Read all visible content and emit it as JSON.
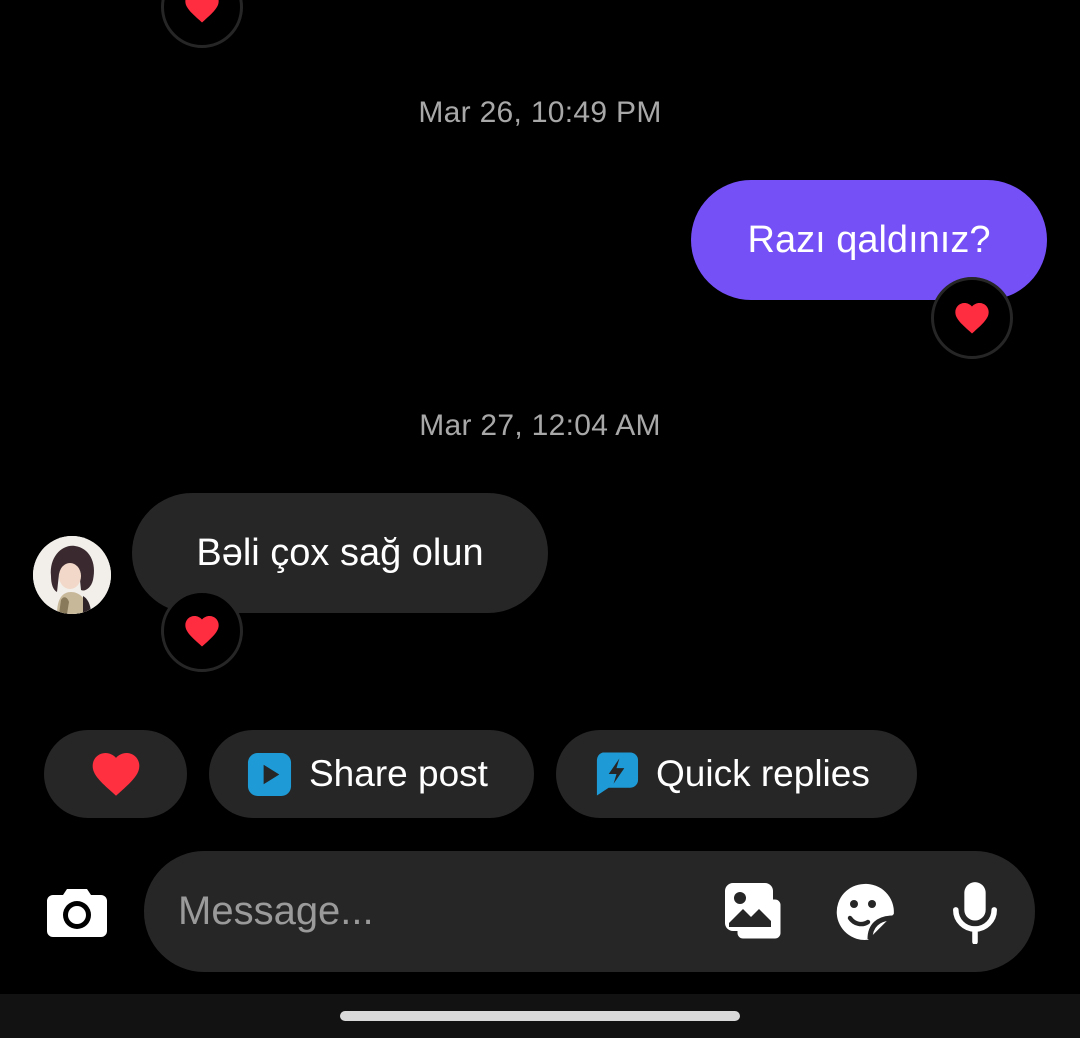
{
  "conversation": {
    "messages": [
      {
        "kind": "timestamp",
        "text": "Mar 26, 10:49 PM"
      },
      {
        "kind": "outgoing",
        "text": "Razı qaldınız?",
        "reaction": "red-heart"
      },
      {
        "kind": "timestamp",
        "text": "Mar 27, 12:04 AM"
      },
      {
        "kind": "incoming",
        "text": "Bəli çox sağ olun",
        "reaction": "red-heart"
      }
    ]
  },
  "quick_actions": {
    "heart_icon": "red-heart",
    "share_post": {
      "label": "Share post",
      "icon": "play-square-icon"
    },
    "quick_replies": {
      "label": "Quick replies",
      "icon": "lightning-bubble-icon"
    }
  },
  "composer": {
    "placeholder": "Message...",
    "value": "",
    "icons": [
      "camera-icon",
      "gallery-icon",
      "sticker-icon",
      "microphone-icon"
    ]
  },
  "colors": {
    "outgoing_bubble": "#7450f6",
    "incoming_bubble": "#262626",
    "accent_blue": "#1e9bd7",
    "heart_red": "#ff3040"
  }
}
